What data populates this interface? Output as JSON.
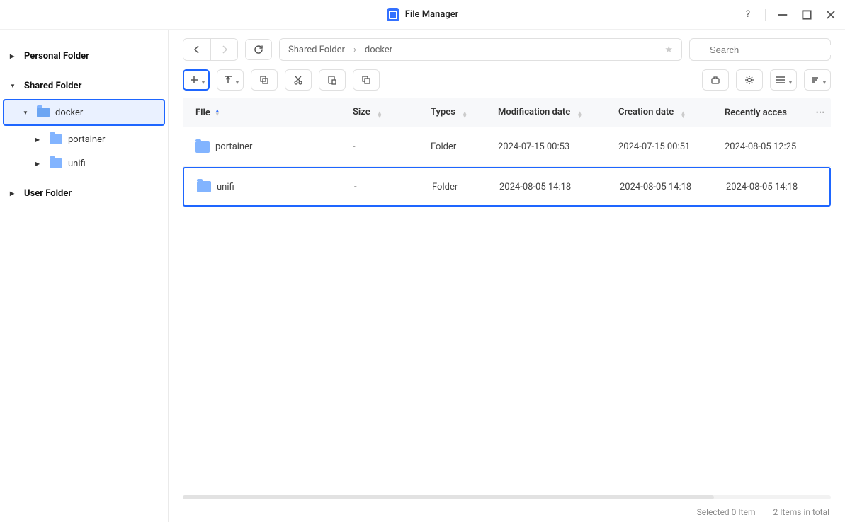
{
  "app": {
    "title": "File Manager"
  },
  "sidebar": {
    "personal": {
      "label": "Personal Folder"
    },
    "shared": {
      "label": "Shared Folder",
      "docker": {
        "label": "docker",
        "children": {
          "portainer": "portainer",
          "unifi": "unifi"
        }
      }
    },
    "user": {
      "label": "User Folder"
    }
  },
  "breadcrumb": {
    "seg0": "Shared Folder",
    "seg1": "docker"
  },
  "search": {
    "placeholder": "Search"
  },
  "columns": {
    "file": "File",
    "size": "Size",
    "type": "Types",
    "mod": "Modification date",
    "create": "Creation date",
    "access": "Recently acces"
  },
  "rows": [
    {
      "name": "portainer",
      "size": "-",
      "type": "Folder",
      "mod": "2024-07-15 00:53",
      "create": "2024-07-15 00:51",
      "access": "2024-08-05 12:25"
    },
    {
      "name": "unifi",
      "size": "-",
      "type": "Folder",
      "mod": "2024-08-05 14:18",
      "create": "2024-08-05 14:18",
      "access": "2024-08-05 14:18"
    }
  ],
  "status": {
    "selected": "Selected 0 Item",
    "total": "2 Items in total"
  }
}
